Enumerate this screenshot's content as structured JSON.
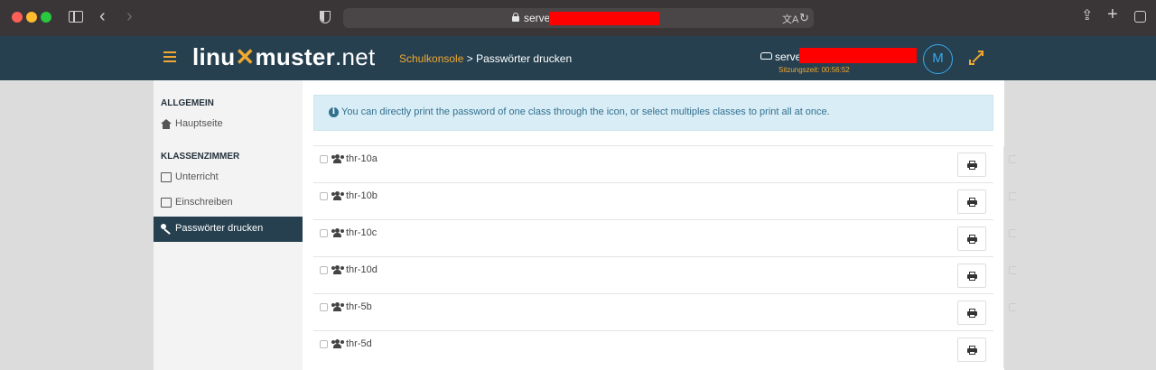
{
  "browser": {
    "url": "server",
    "translate_glyph": "⽂A",
    "reload_glyph": "↻",
    "back_glyph": "‹",
    "forward_glyph": "›",
    "share_glyph": "⇪",
    "newtab_glyph": "+"
  },
  "header": {
    "logo_linu": "linu",
    "logo_x": "✕",
    "logo_muster": "muster",
    "logo_net": ".net",
    "breadcrumb_root": "Schulkonsole",
    "breadcrumb_sep": " > ",
    "breadcrumb_current": "Passwörter drucken",
    "server_name": "server",
    "session_label": "Sitzungszeit: 00:56:52",
    "avatar_initial": "M"
  },
  "sidebar": {
    "sections": [
      {
        "title": "ALLGEMEIN"
      },
      {
        "title": "KLASSENZIMMER"
      }
    ],
    "items": [
      {
        "label": "Hauptseite",
        "icon": "home-icon"
      },
      {
        "label": "Unterricht",
        "icon": "monitor-icon"
      },
      {
        "label": "Einschreiben",
        "icon": "edit-icon"
      },
      {
        "label": "Passwörter drucken",
        "icon": "key-icon",
        "active": true
      }
    ]
  },
  "main": {
    "info_text": "You can directly print the password of one class through the icon, or select multiples classes to print all at once.",
    "info_glyph": "i",
    "classes": [
      {
        "name": "thr-10a"
      },
      {
        "name": "thr-10b"
      },
      {
        "name": "thr-10c"
      },
      {
        "name": "thr-10d"
      },
      {
        "name": "thr-5b"
      },
      {
        "name": "thr-5d"
      }
    ]
  },
  "colors": {
    "header_bg": "#264050",
    "accent_orange": "#f0a830",
    "info_bg": "#d9edf6",
    "info_text": "#31708f",
    "avatar_blue": "#3aa8e8"
  }
}
